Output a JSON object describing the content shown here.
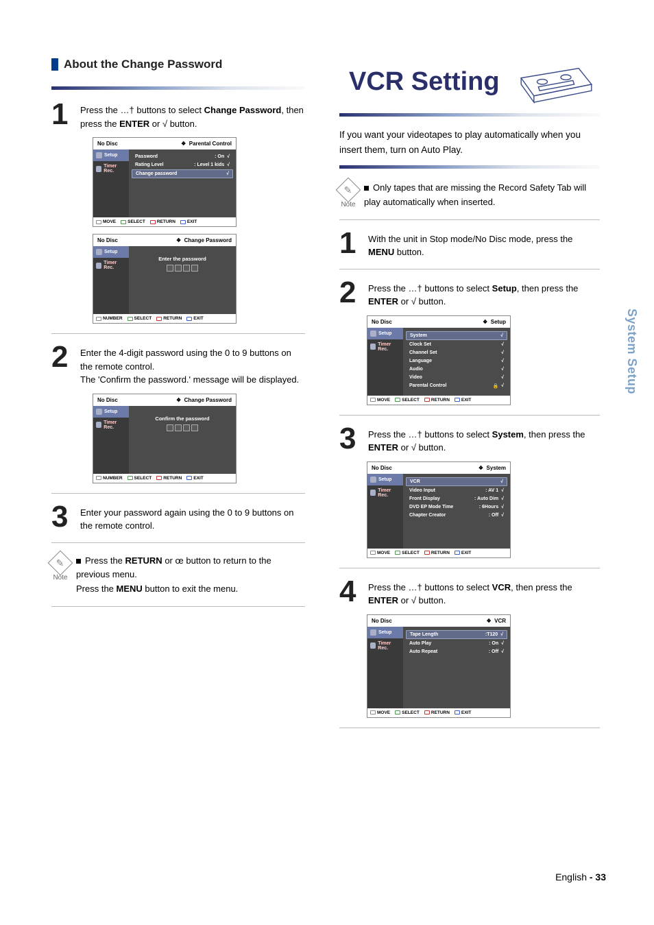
{
  "left": {
    "section_title": "About the Change Password",
    "step1": {
      "text_a": "Press the ",
      "text_b": " buttons to select ",
      "bold1": "Change Password",
      "text_c": ", then press the ",
      "bold2": "ENTER",
      "text_d": " or ",
      "text_e": " button."
    },
    "osd1": {
      "topleft": "No Disc",
      "topright": "Parental Control",
      "side_setup": "Setup",
      "side_timer": "Timer Rec.",
      "rows": [
        {
          "lbl": "Password",
          "val": ": On",
          "arr": "√"
        },
        {
          "lbl": "Rating Level",
          "val": ": Level 1 kids",
          "arr": "√"
        },
        {
          "lbl": "Change password",
          "val": "",
          "arr": "√",
          "hl": true
        }
      ],
      "foot": [
        "MOVE",
        "SELECT",
        "RETURN",
        "EXIT"
      ]
    },
    "osd2": {
      "topleft": "No Disc",
      "topright": "Change Password",
      "side_setup": "Setup",
      "side_timer": "Timer Rec.",
      "caption": "Enter the password",
      "foot": [
        "NUMBER",
        "SELECT",
        "RETURN",
        "EXIT"
      ]
    },
    "step2": "Enter the 4-digit password using the 0 to 9 buttons on the remote control.\nThe 'Confirm the password.' message will be displayed.",
    "osd3": {
      "topleft": "No Disc",
      "topright": "Change Password",
      "side_setup": "Setup",
      "side_timer": "Timer Rec.",
      "caption": "Confirm the password",
      "foot": [
        "NUMBER",
        "SELECT",
        "RETURN",
        "EXIT"
      ]
    },
    "step3": "Enter your password again using the 0 to 9 buttons on the remote control.",
    "note_a": "Press the ",
    "note_bold1": "RETURN",
    "note_b": " or ",
    "note_c": " button to return to the previous menu.",
    "note_d": "Press the ",
    "note_bold2": "MENU",
    "note_e": " button to exit the menu.",
    "note_label": "Note"
  },
  "right": {
    "title": "VCR Setting",
    "intro": "If you want your videotapes to play automatically when you insert them, turn on Auto Play.",
    "note_label": "Note",
    "note": "Only tapes that are missing the Record Safety Tab will play automatically when inserted.",
    "step1_a": "With the unit in Stop mode/No Disc mode, press the ",
    "step1_b": " button.",
    "step1_bold": "MENU",
    "step2_a": "Press the ",
    "step2_b": " buttons to select ",
    "step2_bold1": "Setup",
    "step2_c": ", then press the ",
    "step2_bold2": "ENTER",
    "step2_d": " or ",
    "step2_e": " button.",
    "osd_setup": {
      "topleft": "No Disc",
      "topright": "Setup",
      "side_setup": "Setup",
      "side_timer": "Timer Rec.",
      "rows": [
        {
          "lbl": "System",
          "val": "",
          "arr": "√",
          "hl": true
        },
        {
          "lbl": "Clock Set",
          "val": "",
          "arr": "√"
        },
        {
          "lbl": "Channel Set",
          "val": "",
          "arr": "√"
        },
        {
          "lbl": "Language",
          "val": "",
          "arr": "√"
        },
        {
          "lbl": "Audio",
          "val": "",
          "arr": "√"
        },
        {
          "lbl": "Video",
          "val": "",
          "arr": "√"
        },
        {
          "lbl": "Parental Control",
          "val": "",
          "arr": "√",
          "lock": true
        }
      ],
      "foot": [
        "MOVE",
        "SELECT",
        "RETURN",
        "EXIT"
      ]
    },
    "step3_a": "Press the ",
    "step3_b": " buttons to select ",
    "step3_bold1": "System",
    "step3_c": ", then press the ",
    "step3_bold2": "ENTER",
    "step3_d": " or ",
    "step3_e": " button.",
    "osd_system": {
      "topleft": "No Disc",
      "topright": "System",
      "side_setup": "Setup",
      "side_timer": "Timer Rec.",
      "rows": [
        {
          "lbl": "VCR",
          "val": "",
          "arr": "√",
          "hl": true
        },
        {
          "lbl": "Video Input",
          "val": ": AV 1",
          "arr": "√"
        },
        {
          "lbl": "Front Display",
          "val": ": Auto Dim",
          "arr": "√"
        },
        {
          "lbl": "DVD EP Mode Time",
          "val": ": 6Hours",
          "arr": "√"
        },
        {
          "lbl": "Chapter Creator",
          "val": ": Off",
          "arr": "√"
        }
      ],
      "foot": [
        "MOVE",
        "SELECT",
        "RETURN",
        "EXIT"
      ]
    },
    "step4_a": "Press the ",
    "step4_b": " buttons to select ",
    "step4_bold1": "VCR",
    "step4_c": ", then press the ",
    "step4_bold2": "ENTER",
    "step4_d": " or ",
    "step4_e": " button.",
    "osd_vcr": {
      "topleft": "No Disc",
      "topright": "VCR",
      "side_setup": "Setup",
      "side_timer": "Timer Rec.",
      "rows": [
        {
          "lbl": "Tape Length",
          "val": ":T120",
          "arr": "√",
          "hl": true
        },
        {
          "lbl": "Auto Play",
          "val": ": On",
          "arr": "√"
        },
        {
          "lbl": "Auto Repeat",
          "val": ": Off",
          "arr": "√"
        }
      ],
      "foot": [
        "MOVE",
        "SELECT",
        "RETURN",
        "EXIT"
      ]
    }
  },
  "sidetab": "System Setup",
  "footer_a": "English ",
  "footer_b": "- 33",
  "glyphs": {
    "updown": "…†",
    "right": "√",
    "left": "œ",
    "diamond": "❖"
  }
}
